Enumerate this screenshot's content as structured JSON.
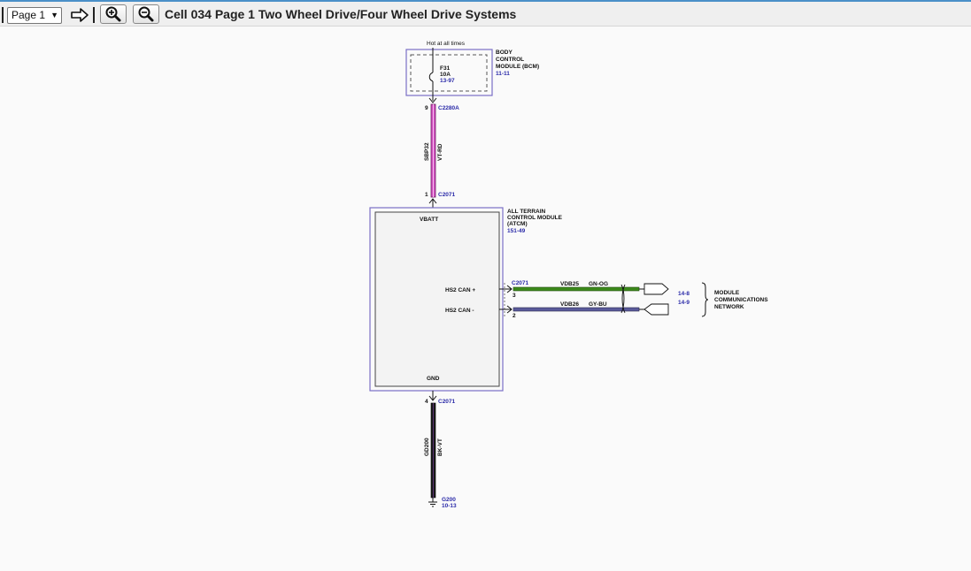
{
  "toolbar": {
    "page_select": "Page 1",
    "title": "Cell 034 Page 1 Two Wheel Drive/Four Wheel Drive Systems"
  },
  "icons": {
    "next": "arrow-right-icon",
    "zoom_in": "zoom-in-icon",
    "zoom_out": "zoom-out-icon"
  },
  "colors": {
    "module_border": "#7a6fc6",
    "ref_text": "#2a2aa8",
    "wire_violet": "#d24fc0",
    "wire_black": "#1a1a1a",
    "wire_green": "#3c8a1c",
    "wire_grayblue": "#5a5a9a"
  },
  "diagram": {
    "bcm": {
      "hot_label": "Hot at all times",
      "name": [
        "BODY",
        "CONTROL",
        "MODULE (BCM)"
      ],
      "ref": "11-11",
      "fuse_name": "F31",
      "fuse_rating": "10A",
      "fuse_ref": "13-97",
      "pin": "9",
      "connector": "C2280A"
    },
    "wire_power": {
      "circuit": "SBP32",
      "color": "VT-RD"
    },
    "atcm": {
      "top_pin": "1",
      "top_connector": "C2071",
      "name": [
        "ALL TERRAIN",
        "CONTROL MODULE",
        "(ATCM)"
      ],
      "ref": "151-49",
      "vbatt": "VBATT",
      "can_plus": "HS2 CAN +",
      "can_minus": "HS2 CAN -",
      "gnd": "GND",
      "can_connector": "C2071",
      "pin_plus": "3",
      "pin_minus": "2",
      "gnd_pin": "4",
      "gnd_connector": "C2071"
    },
    "can_plus_wire": {
      "circuit": "VDB25",
      "color": "GN-OG",
      "ref": "14-8"
    },
    "can_minus_wire": {
      "circuit": "VDB26",
      "color": "GY-BU",
      "ref": "14-9"
    },
    "network": [
      "MODULE",
      "COMMUNICATIONS",
      "NETWORK"
    ],
    "wire_ground": {
      "circuit": "GD200",
      "color": "BK-VT"
    },
    "ground": {
      "name": "G200",
      "ref": "10-13"
    }
  }
}
